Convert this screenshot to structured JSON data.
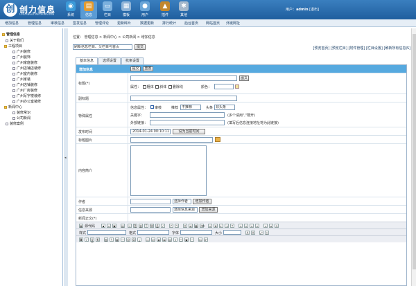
{
  "app": {
    "logo_mark": "创",
    "logo_text": "创力信息",
    "logo_sub": "CHUANGLI INFORMATION"
  },
  "topnav": [
    {
      "label": "系统",
      "icon": "system-icon",
      "color": "#3b9ad9"
    },
    {
      "label": "信息",
      "icon": "info-icon",
      "color": "#e59b2e"
    },
    {
      "label": "栏目",
      "icon": "column-icon",
      "color": "#7bb0de"
    },
    {
      "label": "模板",
      "icon": "template-icon",
      "color": "#8fb4d8"
    },
    {
      "label": "用户",
      "icon": "user-icon",
      "color": "#6aa5d8"
    },
    {
      "label": "插件",
      "icon": "plugin-icon",
      "color": "#c2872e"
    },
    {
      "label": "其他",
      "icon": "gear-icon",
      "color": "#a6b9cc"
    }
  ],
  "user": {
    "prefix": "用户：",
    "name": "admin",
    "logout": "[退出]"
  },
  "submenu": [
    "增加信息",
    "管理信息",
    "审核信息",
    "签发信息",
    "管理评论",
    "更新碎片",
    "数据更新",
    "排行统计",
    "后台首页",
    "网站首页",
    "外链网址"
  ],
  "sidebar": {
    "root": "管理信息",
    "items": [
      "关于我们",
      "工程项目",
      "广州装修",
      "广州装饰",
      "广州家庭装修",
      "广州店铺店装修",
      "广州室内装修",
      "广州家装",
      "广州店铺装修",
      "广州厂房装修",
      "广州写字楼装修",
      "广州办公室装修",
      "新闻中心",
      "装修常识",
      "公司新闻",
      "装修案例"
    ]
  },
  "breadcrumb": "位置：  管理信息 > 新闻中心 > 公司新闻 > 增加信息",
  "toolbar": {
    "select_value": "刷新信息栏目、父栏目与首页",
    "submit_label": "提交",
    "right_links": "[预览首页] [预览栏目] [附件管理] [栏目设置] [刷新所有信息JS]"
  },
  "tabs": [
    "基本信息",
    "选项设置",
    "抗条设置"
  ],
  "form": {
    "head_title": "增加信息",
    "submit": "提交",
    "reset": "重置",
    "title_label": "标题(*)",
    "title_btn": "图文",
    "attr_label": "属性：",
    "attr_bold": "粗体",
    "attr_italic": "斜体",
    "attr_strike": "删除线",
    "color_label": "颜色：",
    "subtitle_label": "副标题",
    "special_label": "特殊属性",
    "info_attr_label": "信息属性：",
    "audit_label": "审核",
    "recommend_label": "推荐",
    "recommend_value": "不推荐",
    "headline_label": "头条",
    "headline_value": "非头条",
    "keywords_label": "关键字：",
    "keywords_hint": "(多个请用\",\"隔开)",
    "link_label": "外部链接：",
    "link_hint": "(填写后信息连接地址将为此链接)",
    "time_label": "发布时间",
    "time_value": "2014-01-24 00:10:11",
    "time_btn": "设为当前时间",
    "image_label": "标题图片",
    "intro_label": "内容简介",
    "author_label": "作者",
    "author_select": "选择作者",
    "author_btn": "增加作者",
    "source_label": "信息来源",
    "source_select": "选择信息来源",
    "source_btn": "增加来源",
    "content_label": "新闻正文(*)",
    "editor_source": "源代码",
    "editor_style": "样式",
    "editor_format": "格式",
    "editor_font": "字体",
    "editor_size": "大小"
  }
}
